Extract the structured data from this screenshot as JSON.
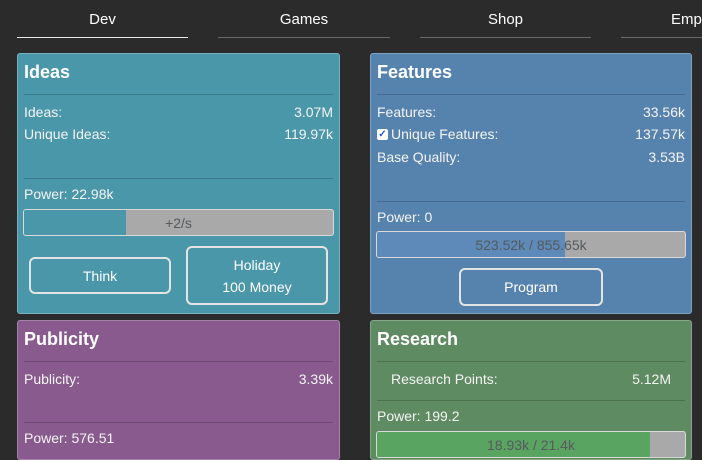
{
  "tabs": [
    {
      "label": "Dev",
      "active": true
    },
    {
      "label": "Games",
      "active": false
    },
    {
      "label": "Shop",
      "active": false
    },
    {
      "label": "Emp",
      "active": false
    }
  ],
  "ideas": {
    "title": "Ideas",
    "rows": [
      {
        "label": "Ideas:",
        "value": "3.07M"
      },
      {
        "label": "Unique Ideas:",
        "value": "119.97k"
      }
    ],
    "power": "Power: 22.98k",
    "bar": {
      "text": "+2/s",
      "fill_fraction": 0.33,
      "fill_color": "#4a97aa"
    },
    "buttons": {
      "think": "Think",
      "holiday_line1": "Holiday",
      "holiday_line2": "100 Money"
    }
  },
  "features": {
    "title": "Features",
    "rows": [
      {
        "label": "Features:",
        "value": "33.56k"
      },
      {
        "label": "Unique Features:",
        "value": "137.57k",
        "checked": true
      },
      {
        "label": "Base Quality:",
        "value": "3.53B"
      }
    ],
    "power": "Power: 0",
    "bar": {
      "text": "523.52k / 855.65k",
      "fill_fraction": 0.612,
      "fill_color": "#5d8ab8"
    },
    "buttons": {
      "program": "Program"
    }
  },
  "publicity": {
    "title": "Publicity",
    "rows": [
      {
        "label": "Publicity:",
        "value": "3.39k"
      }
    ],
    "power": "Power: 576.51"
  },
  "research": {
    "title": "Research",
    "rows": [
      {
        "label": "Research Points:",
        "value": "5.12M"
      }
    ],
    "power": "Power: 199.2",
    "bar": {
      "text": "18.93k / 21.4k",
      "fill_fraction": 0.885,
      "fill_color": "#5aa462"
    }
  },
  "colors": {
    "ideas": "#4a97aa",
    "features": "#5683ad",
    "publicity": "#885a8e",
    "research": "#5e8b62"
  }
}
